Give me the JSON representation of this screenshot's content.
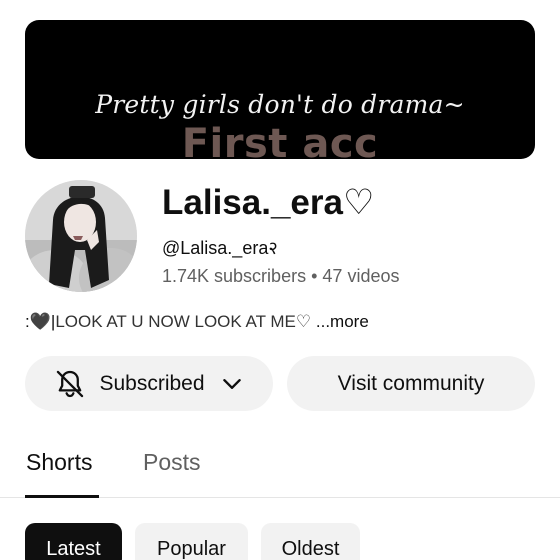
{
  "banner": {
    "line1": "Pretty girls don't do drama~",
    "line2": "First acc"
  },
  "channel": {
    "name": "Lalisa._era♡",
    "handle": "@Lalisa._era२",
    "subscribers": "1.74K subscribers",
    "separator": "•",
    "videos": "47 videos",
    "description_prefix": ":🖤|",
    "description": "LOOK AT U NOW LOOK AT ME♡",
    "more_label": "...more"
  },
  "actions": {
    "subscribed_label": "Subscribed",
    "community_label": "Visit community",
    "bell_icon": "bell-off-icon",
    "chevron_icon": "chevron-down-icon"
  },
  "tabs": [
    {
      "label": "Shorts",
      "selected": true
    },
    {
      "label": "Posts",
      "selected": false
    }
  ],
  "filters": [
    {
      "label": "Latest",
      "selected": true
    },
    {
      "label": "Popular",
      "selected": false
    },
    {
      "label": "Oldest",
      "selected": false
    }
  ],
  "colors": {
    "banner_bg": "#000000",
    "banner_subtitle": "#6e5853",
    "button_bg": "#f2f2f2",
    "text_primary": "#0f0f0f",
    "text_secondary": "#606060"
  }
}
